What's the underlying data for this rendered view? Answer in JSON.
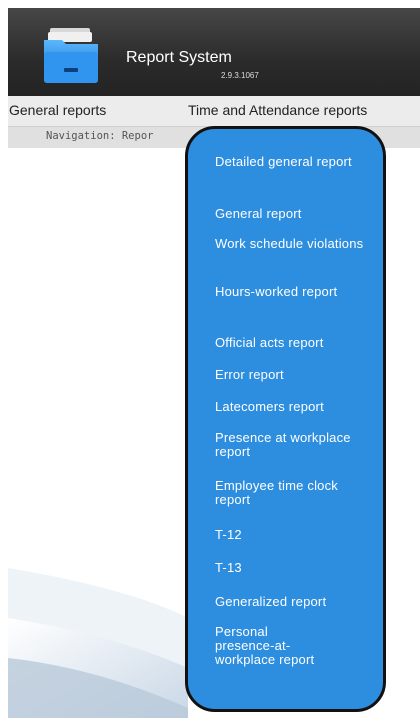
{
  "app": {
    "title": "Report System",
    "version": "2.9.3.1067"
  },
  "menu": [
    {
      "label": "General reports"
    },
    {
      "label": "Time and Attendance reports"
    }
  ],
  "navigation": {
    "text": "Navigation: Repor"
  },
  "dropdown": {
    "items": [
      {
        "label": "Detailed general report"
      },
      {
        "label": "General report"
      },
      {
        "label": "Work schedule violations"
      },
      {
        "label": "Hours-worked report"
      },
      {
        "label": "Official acts report"
      },
      {
        "label": "Error report"
      },
      {
        "label": "Latecomers report"
      },
      {
        "label": "Presence at workplace report"
      },
      {
        "label": "Employee time clock report"
      },
      {
        "label": "T-12"
      },
      {
        "label": "T-13"
      },
      {
        "label": "Generalized report"
      },
      {
        "label": "Personal presence-at-workplace report"
      }
    ]
  },
  "colors": {
    "header_bg": "#2b2b2b",
    "dropdown_bg": "#2d8ee0",
    "menubar_bg": "#ececec"
  },
  "icons": {
    "logo": "folder-icon"
  }
}
